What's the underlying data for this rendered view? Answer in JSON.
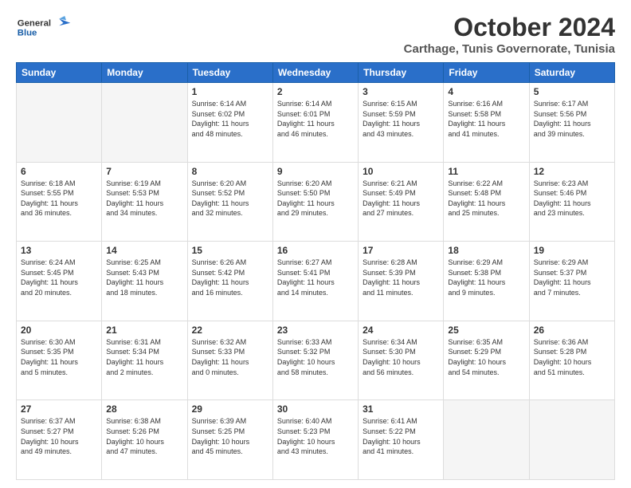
{
  "header": {
    "logo_general": "General",
    "logo_blue": "Blue",
    "title": "October 2024",
    "location": "Carthage, Tunis Governorate, Tunisia"
  },
  "days_of_week": [
    "Sunday",
    "Monday",
    "Tuesday",
    "Wednesday",
    "Thursday",
    "Friday",
    "Saturday"
  ],
  "weeks": [
    [
      {
        "day": "",
        "info": ""
      },
      {
        "day": "",
        "info": ""
      },
      {
        "day": "1",
        "info": "Sunrise: 6:14 AM\nSunset: 6:02 PM\nDaylight: 11 hours\nand 48 minutes."
      },
      {
        "day": "2",
        "info": "Sunrise: 6:14 AM\nSunset: 6:01 PM\nDaylight: 11 hours\nand 46 minutes."
      },
      {
        "day": "3",
        "info": "Sunrise: 6:15 AM\nSunset: 5:59 PM\nDaylight: 11 hours\nand 43 minutes."
      },
      {
        "day": "4",
        "info": "Sunrise: 6:16 AM\nSunset: 5:58 PM\nDaylight: 11 hours\nand 41 minutes."
      },
      {
        "day": "5",
        "info": "Sunrise: 6:17 AM\nSunset: 5:56 PM\nDaylight: 11 hours\nand 39 minutes."
      }
    ],
    [
      {
        "day": "6",
        "info": "Sunrise: 6:18 AM\nSunset: 5:55 PM\nDaylight: 11 hours\nand 36 minutes."
      },
      {
        "day": "7",
        "info": "Sunrise: 6:19 AM\nSunset: 5:53 PM\nDaylight: 11 hours\nand 34 minutes."
      },
      {
        "day": "8",
        "info": "Sunrise: 6:20 AM\nSunset: 5:52 PM\nDaylight: 11 hours\nand 32 minutes."
      },
      {
        "day": "9",
        "info": "Sunrise: 6:20 AM\nSunset: 5:50 PM\nDaylight: 11 hours\nand 29 minutes."
      },
      {
        "day": "10",
        "info": "Sunrise: 6:21 AM\nSunset: 5:49 PM\nDaylight: 11 hours\nand 27 minutes."
      },
      {
        "day": "11",
        "info": "Sunrise: 6:22 AM\nSunset: 5:48 PM\nDaylight: 11 hours\nand 25 minutes."
      },
      {
        "day": "12",
        "info": "Sunrise: 6:23 AM\nSunset: 5:46 PM\nDaylight: 11 hours\nand 23 minutes."
      }
    ],
    [
      {
        "day": "13",
        "info": "Sunrise: 6:24 AM\nSunset: 5:45 PM\nDaylight: 11 hours\nand 20 minutes."
      },
      {
        "day": "14",
        "info": "Sunrise: 6:25 AM\nSunset: 5:43 PM\nDaylight: 11 hours\nand 18 minutes."
      },
      {
        "day": "15",
        "info": "Sunrise: 6:26 AM\nSunset: 5:42 PM\nDaylight: 11 hours\nand 16 minutes."
      },
      {
        "day": "16",
        "info": "Sunrise: 6:27 AM\nSunset: 5:41 PM\nDaylight: 11 hours\nand 14 minutes."
      },
      {
        "day": "17",
        "info": "Sunrise: 6:28 AM\nSunset: 5:39 PM\nDaylight: 11 hours\nand 11 minutes."
      },
      {
        "day": "18",
        "info": "Sunrise: 6:29 AM\nSunset: 5:38 PM\nDaylight: 11 hours\nand 9 minutes."
      },
      {
        "day": "19",
        "info": "Sunrise: 6:29 AM\nSunset: 5:37 PM\nDaylight: 11 hours\nand 7 minutes."
      }
    ],
    [
      {
        "day": "20",
        "info": "Sunrise: 6:30 AM\nSunset: 5:35 PM\nDaylight: 11 hours\nand 5 minutes."
      },
      {
        "day": "21",
        "info": "Sunrise: 6:31 AM\nSunset: 5:34 PM\nDaylight: 11 hours\nand 2 minutes."
      },
      {
        "day": "22",
        "info": "Sunrise: 6:32 AM\nSunset: 5:33 PM\nDaylight: 11 hours\nand 0 minutes."
      },
      {
        "day": "23",
        "info": "Sunrise: 6:33 AM\nSunset: 5:32 PM\nDaylight: 10 hours\nand 58 minutes."
      },
      {
        "day": "24",
        "info": "Sunrise: 6:34 AM\nSunset: 5:30 PM\nDaylight: 10 hours\nand 56 minutes."
      },
      {
        "day": "25",
        "info": "Sunrise: 6:35 AM\nSunset: 5:29 PM\nDaylight: 10 hours\nand 54 minutes."
      },
      {
        "day": "26",
        "info": "Sunrise: 6:36 AM\nSunset: 5:28 PM\nDaylight: 10 hours\nand 51 minutes."
      }
    ],
    [
      {
        "day": "27",
        "info": "Sunrise: 6:37 AM\nSunset: 5:27 PM\nDaylight: 10 hours\nand 49 minutes."
      },
      {
        "day": "28",
        "info": "Sunrise: 6:38 AM\nSunset: 5:26 PM\nDaylight: 10 hours\nand 47 minutes."
      },
      {
        "day": "29",
        "info": "Sunrise: 6:39 AM\nSunset: 5:25 PM\nDaylight: 10 hours\nand 45 minutes."
      },
      {
        "day": "30",
        "info": "Sunrise: 6:40 AM\nSunset: 5:23 PM\nDaylight: 10 hours\nand 43 minutes."
      },
      {
        "day": "31",
        "info": "Sunrise: 6:41 AM\nSunset: 5:22 PM\nDaylight: 10 hours\nand 41 minutes."
      },
      {
        "day": "",
        "info": ""
      },
      {
        "day": "",
        "info": ""
      }
    ]
  ]
}
